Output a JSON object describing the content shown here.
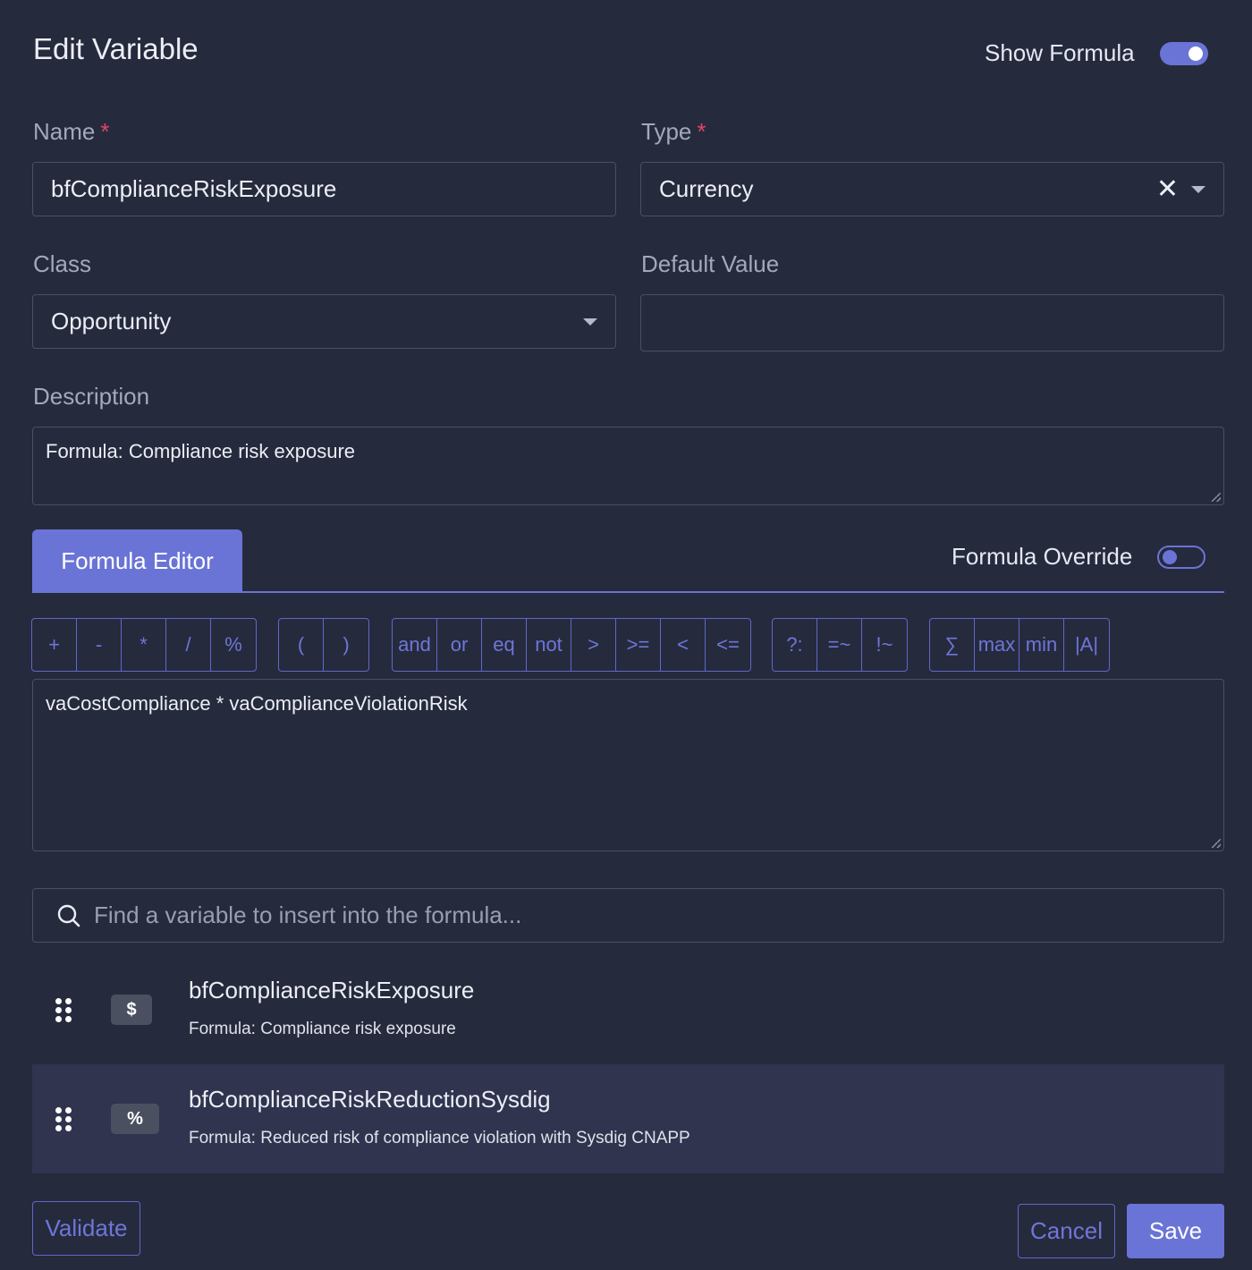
{
  "header": {
    "title": "Edit Variable",
    "show_formula_label": "Show Formula",
    "show_formula_on": true
  },
  "form": {
    "name": {
      "label": "Name",
      "required_mark": "*",
      "value": "bfComplianceRiskExposure"
    },
    "type": {
      "label": "Type",
      "required_mark": "*",
      "value": "Currency",
      "clear_glyph": "✕"
    },
    "class": {
      "label": "Class",
      "value": "Opportunity"
    },
    "default_value": {
      "label": "Default Value",
      "value": ""
    },
    "description": {
      "label": "Description",
      "value": "Formula: Compliance risk exposure"
    }
  },
  "formula": {
    "tab_label": "Formula Editor",
    "override_label": "Formula Override",
    "override_on": false,
    "operator_groups": [
      [
        "+",
        "-",
        "*",
        "/",
        "%"
      ],
      [
        "(",
        ")"
      ],
      [
        "and",
        "or",
        "eq",
        "not",
        ">",
        ">=",
        "<",
        "<="
      ],
      [
        "?:",
        "=~",
        "!~"
      ],
      [
        "∑",
        "max",
        "min",
        "|A|"
      ]
    ],
    "expression": "vaCostCompliance * vaComplianceViolationRisk"
  },
  "search": {
    "placeholder": "Find a variable to insert into the formula..."
  },
  "variables": [
    {
      "badge": "$",
      "name": "bfComplianceRiskExposure",
      "description": "Formula: Compliance risk exposure"
    },
    {
      "badge": "%",
      "name": "bfComplianceRiskReductionSysdig",
      "description": "Formula: Reduced risk of compliance violation with Sysdig CNAPP"
    }
  ],
  "footer": {
    "validate": "Validate",
    "cancel": "Cancel",
    "save": "Save"
  },
  "colors": {
    "accent": "#6a74d6",
    "background": "#262a3d",
    "required": "#e0456a"
  }
}
